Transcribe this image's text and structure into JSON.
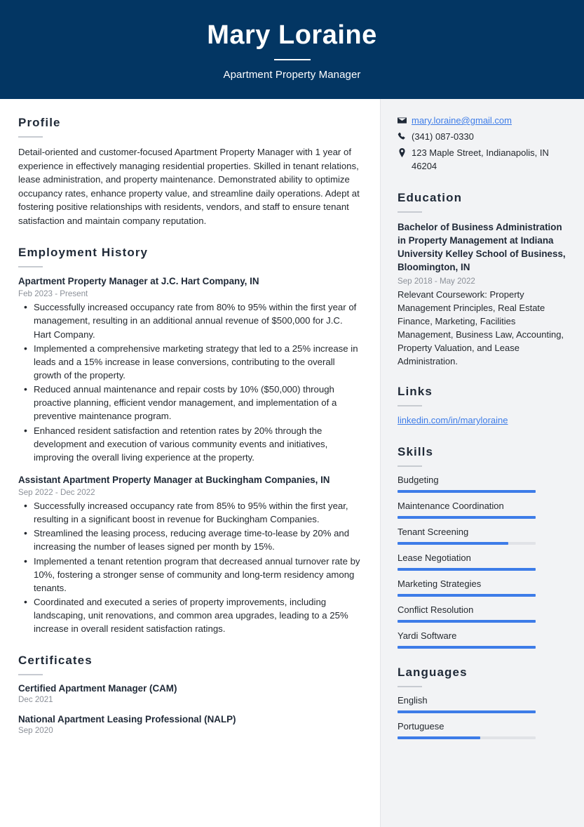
{
  "header": {
    "name": "Mary Loraine",
    "title": "Apartment Property Manager",
    "background_color": "#033663"
  },
  "theme": {
    "accent_color": "#3d7ce8",
    "sidebar_color": "#f2f3f5",
    "heading_color": "#1f2937"
  },
  "main": {
    "profile": {
      "heading": "Profile",
      "text": "Detail-oriented and customer-focused Apartment Property Manager with 1 year of experience in effectively managing residential properties. Skilled in tenant relations, lease administration, and property maintenance. Demonstrated ability to optimize occupancy rates, enhance property value, and streamline daily operations. Adept at fostering positive relationships with residents, vendors, and staff to ensure tenant satisfaction and maintain company reputation."
    },
    "employment": {
      "heading": "Employment History",
      "jobs": [
        {
          "title": "Apartment Property Manager at J.C. Hart Company, IN",
          "date": "Feb 2023 - Present",
          "bullets": [
            "Successfully increased occupancy rate from 80% to 95% within the first year of management, resulting in an additional annual revenue of $500,000 for J.C. Hart Company.",
            "Implemented a comprehensive marketing strategy that led to a 25% increase in leads and a 15% increase in lease conversions, contributing to the overall growth of the property.",
            "Reduced annual maintenance and repair costs by 10% ($50,000) through proactive planning, efficient vendor management, and implementation of a preventive maintenance program.",
            "Enhanced resident satisfaction and retention rates by 20% through the development and execution of various community events and initiatives, improving the overall living experience at the property."
          ]
        },
        {
          "title": "Assistant Apartment Property Manager at Buckingham Companies, IN",
          "date": "Sep 2022 - Dec 2022",
          "bullets": [
            "Successfully increased occupancy rate from 85% to 95% within the first year, resulting in a significant boost in revenue for Buckingham Companies.",
            "Streamlined the leasing process, reducing average time-to-lease by 20% and increasing the number of leases signed per month by 15%.",
            "Implemented a tenant retention program that decreased annual turnover rate by 10%, fostering a stronger sense of community and long-term residency among tenants.",
            "Coordinated and executed a series of property improvements, including landscaping, unit renovations, and common area upgrades, leading to a 25% increase in overall resident satisfaction ratings."
          ]
        }
      ]
    },
    "certificates": {
      "heading": "Certificates",
      "items": [
        {
          "title": "Certified Apartment Manager (CAM)",
          "date": "Dec 2021"
        },
        {
          "title": "National Apartment Leasing Professional (NALP)",
          "date": "Sep 2020"
        }
      ]
    }
  },
  "sidebar": {
    "contact": [
      {
        "icon": "envelope-icon",
        "text": "mary.loraine@gmail.com",
        "is_link": true
      },
      {
        "icon": "phone-icon",
        "text": "(341) 087-0330",
        "is_link": false
      },
      {
        "icon": "location-pin-icon",
        "text": "123 Maple Street, Indianapolis, IN 46204",
        "is_link": false
      }
    ],
    "education": {
      "heading": "Education",
      "degree": "Bachelor of Business Administration in Property Management at Indiana University Kelley School of Business, Bloomington, IN",
      "date": "Sep 2018 - May 2022",
      "description": "Relevant Coursework: Property Management Principles, Real Estate Finance, Marketing, Facilities Management, Business Law, Accounting, Property Valuation, and Lease Administration."
    },
    "links": {
      "heading": "Links",
      "items": [
        {
          "label": "linkedin.com/in/maryloraine"
        }
      ]
    },
    "skills": {
      "heading": "Skills",
      "items": [
        {
          "label": "Budgeting",
          "level": 100
        },
        {
          "label": "Maintenance Coordination",
          "level": 100
        },
        {
          "label": "Tenant Screening",
          "level": 80
        },
        {
          "label": "Lease Negotiation",
          "level": 100
        },
        {
          "label": "Marketing Strategies",
          "level": 100
        },
        {
          "label": "Conflict Resolution",
          "level": 100
        },
        {
          "label": "Yardi Software",
          "level": 100
        }
      ]
    },
    "languages": {
      "heading": "Languages",
      "items": [
        {
          "label": "English",
          "level": 100
        },
        {
          "label": "Portuguese",
          "level": 60
        }
      ]
    }
  }
}
